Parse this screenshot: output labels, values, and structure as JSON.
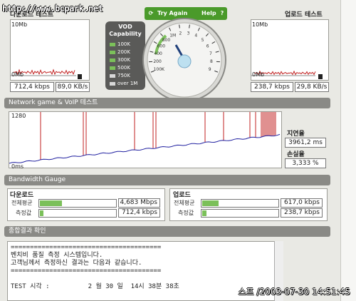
{
  "watermark": "http://www.bcpark.net",
  "timestamp": "스프 /2003-07-30 14:51:45",
  "download": {
    "header": "다운로드 테스트",
    "ymax": "10Mb",
    "ymin": "0Mb",
    "kbps": "712,4 kbps",
    "kbs": "89,0 KB/s"
  },
  "upload": {
    "header": "업로드 테스트",
    "ymax": "10Mb",
    "ymin": "0Mb",
    "kbps": "238,7 kbps",
    "kbs": "29,8 KB/s"
  },
  "vod": {
    "title": "VOD Capability",
    "levels": [
      {
        "label": "100K",
        "color": "#7bc05a"
      },
      {
        "label": "200K",
        "color": "#7bc05a"
      },
      {
        "label": "300K",
        "color": "#7bc05a"
      },
      {
        "label": "500K",
        "color": "#7bc05a"
      },
      {
        "label": "750K",
        "color": "#d8d8d8"
      },
      {
        "label": "over 1M",
        "color": "#d8d8d8"
      }
    ]
  },
  "buttons": {
    "try_again": "Try Again",
    "help": "Help",
    "help_q": "?"
  },
  "dial": {
    "ticks": [
      "100K",
      "200",
      "400",
      "600",
      "800",
      "1M",
      "2",
      "3",
      "4",
      "5",
      "6",
      "7",
      "8",
      "9"
    ]
  },
  "network": {
    "section": "Network game & VoIP 테스트",
    "ymax": "1280",
    "ymin": "0ms",
    "latency_label": "지연율",
    "latency_value": "3961,2 ms",
    "loss_label": "손실율",
    "loss_value": "3,333 %"
  },
  "bandwidth": {
    "section": "Bandwidth Gauge",
    "download_label": "다운로드",
    "upload_label": "업로드",
    "avg_label": "전체평균",
    "meas_label": "측정값",
    "dl_avg": "4,683 Mbps",
    "dl_avg_fill": 0.3,
    "dl_meas": "712,4 kbps",
    "dl_meas_fill": 0.05,
    "ul_avg": "617,0 kbps",
    "ul_avg_fill": 0.22,
    "ul_meas": "238,7 kbps",
    "ul_meas_fill": 0.06
  },
  "result": {
    "section": "종합결과 확인",
    "text": "=======================================\n벤치비 품질 측정 시스템입니다.\n고객님께서 측정하신 결과는 다음과 같습니다.\n=======================================\n\nTEST 시각 :          2 월 30 일  14시 38분 38초"
  },
  "colors": {
    "spike": "#c02020",
    "latency_line": "#2020a0",
    "green": "#4a9a2a"
  }
}
